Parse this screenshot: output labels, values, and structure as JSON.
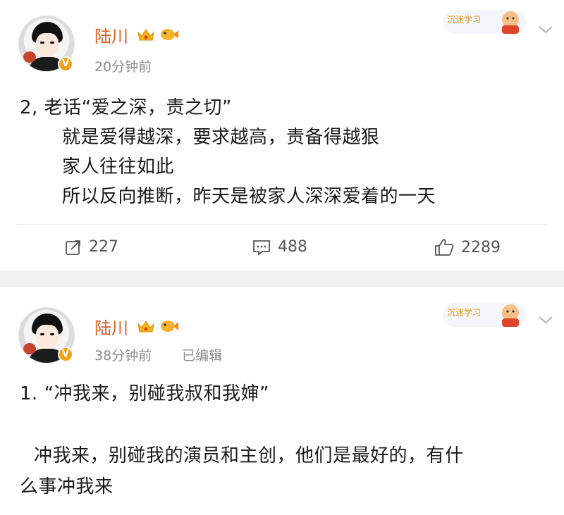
{
  "post1": {
    "username": "陆川",
    "time": "20分钟前",
    "lines": [
      "2,  老话“爱之深，责之切”",
      "就是爱得越深，要求越高，责备得越狠",
      "家人往往如此",
      "所以反向推断，昨天是被家人深深爱着的一天"
    ],
    "actions": {
      "repost": "227",
      "comment": "488",
      "like": "2289"
    },
    "verified_badge": "V",
    "sticker_text": "沉迷学习"
  },
  "post2": {
    "username": "陆川",
    "time": "38分钟前",
    "edited": "已编辑",
    "lines": [
      "1. “冲我来，别碰我叔和我婶”",
      "冲我来，别碰我的演员和主创，他们是最好的，有什",
      "么事冲我来"
    ],
    "verified_badge": "V",
    "sticker_text": "沉迷学习"
  },
  "colors": {
    "username": "#e05c1b",
    "meta": "#8c8c8c",
    "badge": "#f5a316",
    "separator": "#f1f1f1"
  },
  "icons": [
    "crown-icon",
    "fish-icon",
    "chevron-down-icon",
    "repost-icon",
    "comment-icon",
    "like-icon"
  ]
}
